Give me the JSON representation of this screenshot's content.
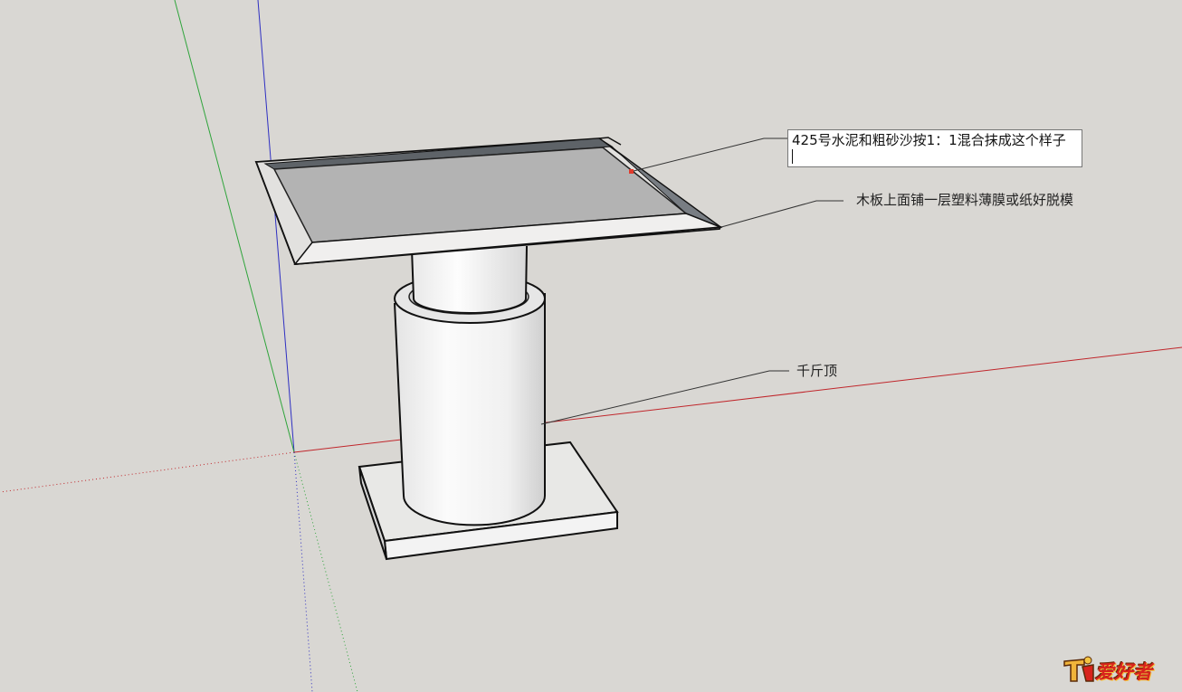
{
  "scene": {
    "axis_colors": {
      "red": "#c0262b",
      "green": "#2fa43b",
      "blue": "#2e2fc2"
    },
    "background_color": "#d9d7d3",
    "face_colors": {
      "top_light": "#e9e8e6",
      "cement_surface": "#b3b3b3",
      "inner_wall": "#6f7378",
      "cylinder_light": "#f6f6f6"
    }
  },
  "annotations": {
    "editing_text": "425号水泥和粗砂沙按1：1混合抹成这个样子",
    "plastic_note": "木板上面铺一层塑料薄膜或纸好脱模",
    "jack_note": "千斤顶"
  },
  "watermark": {
    "text": "爱好者",
    "icon": "woodworking-logo-icon"
  }
}
